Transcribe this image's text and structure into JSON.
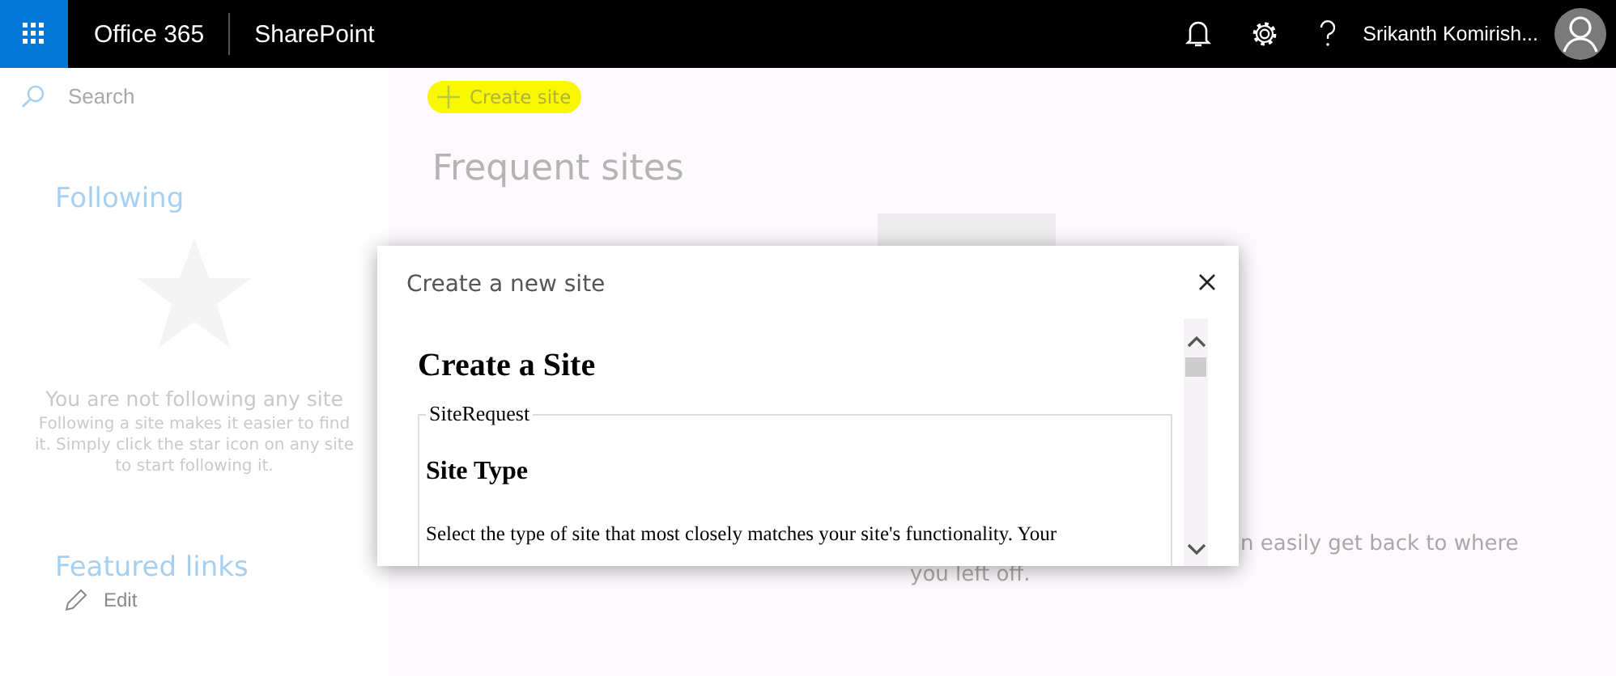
{
  "topbar": {
    "brand": "Office 365",
    "app": "SharePoint",
    "user": "Srikanth Komirish..."
  },
  "sidebar": {
    "search": {
      "placeholder": "Search"
    },
    "following": {
      "title": "Following",
      "empty_title": "You are not following any site",
      "empty_text": "Following a site makes it easier to find it. Simply click the star icon on any site to start following it."
    },
    "featured": {
      "title": "Featured links",
      "edit": "Edit"
    }
  },
  "main": {
    "create_site": {
      "label": "Create site",
      "highlighted": true
    },
    "frequent_title": "Frequent sites",
    "hint_lines": [
      "n easily get back to where",
      "you left off."
    ]
  },
  "dialog": {
    "title": "Create a new site",
    "heading": "Create a Site",
    "fieldset": "SiteRequest",
    "section": "Site Type",
    "text": "Select the type of site that most closely matches your site's functionality. Your"
  }
}
